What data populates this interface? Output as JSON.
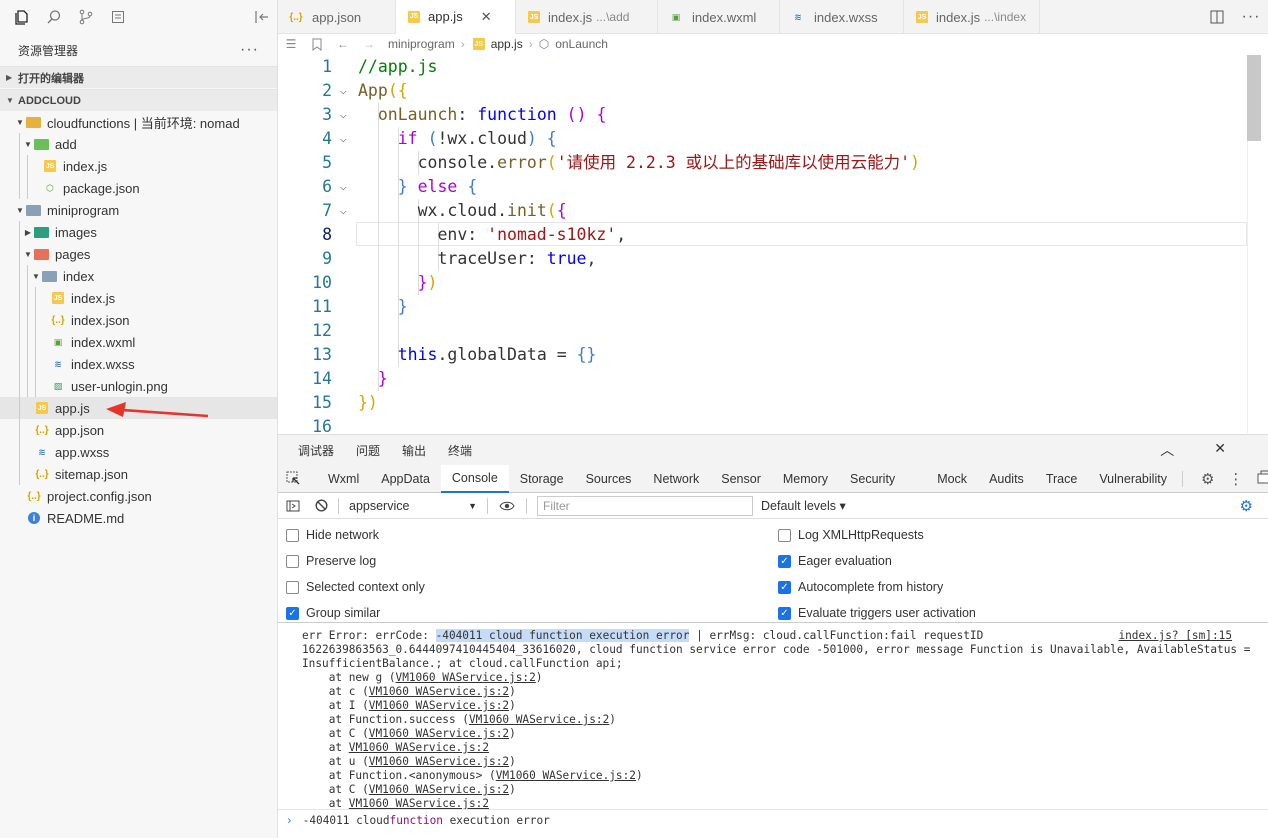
{
  "sidebar": {
    "title": "资源管理器",
    "more": "···",
    "open_editors": "打开的编辑器",
    "project": "ADDCLOUD",
    "tree": [
      {
        "label": "cloudfunctions | 当前环境: nomad",
        "type": "folder",
        "color": "#e8b23a",
        "depth": 0,
        "twisty": "open"
      },
      {
        "label": "add",
        "type": "folder",
        "color": "#6bbf5a",
        "depth": 1,
        "twisty": "open"
      },
      {
        "label": "index.js",
        "type": "js",
        "depth": 2
      },
      {
        "label": "package.json",
        "type": "pkg",
        "depth": 2
      },
      {
        "label": "miniprogram",
        "type": "folder",
        "color": "#8aa0b6",
        "depth": 0,
        "twisty": "open"
      },
      {
        "label": "images",
        "type": "folder",
        "color": "#2a9e7e",
        "depth": 1,
        "twisty": "closed"
      },
      {
        "label": "pages",
        "type": "folder",
        "color": "#e8705a",
        "depth": 1,
        "twisty": "open"
      },
      {
        "label": "index",
        "type": "folder",
        "color": "#8aa0b6",
        "depth": 2,
        "twisty": "open"
      },
      {
        "label": "index.js",
        "type": "js",
        "depth": 3
      },
      {
        "label": "index.json",
        "type": "json",
        "depth": 3
      },
      {
        "label": "index.wxml",
        "type": "wxml",
        "depth": 3
      },
      {
        "label": "index.wxss",
        "type": "wxss",
        "depth": 3
      },
      {
        "label": "user-unlogin.png",
        "type": "img",
        "depth": 3
      },
      {
        "label": "app.js",
        "type": "js",
        "depth": 1,
        "selected": true
      },
      {
        "label": "app.json",
        "type": "json",
        "depth": 1
      },
      {
        "label": "app.wxss",
        "type": "wxss",
        "depth": 1
      },
      {
        "label": "sitemap.json",
        "type": "json",
        "depth": 1
      },
      {
        "label": "project.config.json",
        "type": "json",
        "depth": 0
      },
      {
        "label": "README.md",
        "type": "info",
        "depth": 0
      }
    ]
  },
  "tabs": [
    {
      "label": "app.json",
      "type": "json",
      "sub": ""
    },
    {
      "label": "app.js",
      "type": "js",
      "sub": "",
      "active": true,
      "close": "✕"
    },
    {
      "label": "index.js",
      "type": "js",
      "sub": "...\\add"
    },
    {
      "label": "index.wxml",
      "type": "wxml",
      "sub": ""
    },
    {
      "label": "index.wxss",
      "type": "wxss",
      "sub": ""
    },
    {
      "label": "index.js",
      "type": "js",
      "sub": "...\\index"
    }
  ],
  "breadcrumb": {
    "folder": "miniprogram",
    "file": "app.js",
    "symbol": "onLaunch"
  },
  "editor": {
    "lines": [
      {
        "n": "1",
        "tokens": [
          [
            "c-cm",
            "//app.js"
          ]
        ]
      },
      {
        "n": "2",
        "fold": true,
        "tokens": [
          [
            "c-fn",
            "App"
          ],
          [
            "c-b1",
            "({"
          ]
        ]
      },
      {
        "n": "3",
        "fold": true,
        "tokens": [
          [
            "",
            "  "
          ],
          [
            "c-fn",
            "onLaunch"
          ],
          [
            "",
            ": "
          ],
          [
            "c-kw",
            "function"
          ],
          [
            "",
            " "
          ],
          [
            "c-b2",
            "()"
          ],
          [
            "",
            " "
          ],
          [
            "c-b2",
            "{"
          ]
        ]
      },
      {
        "n": "4",
        "fold": true,
        "tokens": [
          [
            "",
            "    "
          ],
          [
            "c-ctl",
            "if"
          ],
          [
            "",
            " "
          ],
          [
            "c-b3",
            "("
          ],
          [
            "",
            "!wx.cloud"
          ],
          [
            "c-b3",
            ")"
          ],
          [
            "",
            " "
          ],
          [
            "c-b3",
            "{"
          ]
        ]
      },
      {
        "n": "5",
        "tokens": [
          [
            "",
            "      console."
          ],
          [
            "c-fn",
            "error"
          ],
          [
            "c-b1",
            "("
          ],
          [
            "c-str",
            "'请使用 2.2.3 或以上的基础库以使用云能力'"
          ],
          [
            "c-b1",
            ")"
          ]
        ]
      },
      {
        "n": "6",
        "fold": true,
        "tokens": [
          [
            "",
            "    "
          ],
          [
            "c-b3",
            "}"
          ],
          [
            "",
            " "
          ],
          [
            "c-ctl",
            "else"
          ],
          [
            "",
            " "
          ],
          [
            "c-b3",
            "{"
          ]
        ]
      },
      {
        "n": "7",
        "fold": true,
        "tokens": [
          [
            "",
            "      wx.cloud."
          ],
          [
            "c-fn",
            "init"
          ],
          [
            "c-b1",
            "("
          ],
          [
            "c-b2",
            "{"
          ]
        ]
      },
      {
        "n": "8",
        "tokens": [
          [
            "",
            "        env: "
          ],
          [
            "c-str",
            "'nomad-s10kz'"
          ],
          [
            "",
            ","
          ]
        ]
      },
      {
        "n": "9",
        "tokens": [
          [
            "",
            "        traceUser: "
          ],
          [
            "c-kw",
            "true"
          ],
          [
            "",
            ","
          ]
        ]
      },
      {
        "n": "10",
        "tokens": [
          [
            "",
            "      "
          ],
          [
            "c-b2",
            "}"
          ],
          [
            "c-b1",
            ")"
          ]
        ]
      },
      {
        "n": "11",
        "tokens": [
          [
            "",
            "    "
          ],
          [
            "c-b3",
            "}"
          ]
        ]
      },
      {
        "n": "12",
        "tokens": []
      },
      {
        "n": "13",
        "tokens": [
          [
            "",
            "    "
          ],
          [
            "c-kw",
            "this"
          ],
          [
            "",
            ".globalData = "
          ],
          [
            "c-b3",
            "{}"
          ]
        ]
      },
      {
        "n": "14",
        "tokens": [
          [
            "",
            "  "
          ],
          [
            "c-b2",
            "}"
          ]
        ]
      },
      {
        "n": "15",
        "tokens": [
          [
            "c-b1",
            "})"
          ]
        ]
      },
      {
        "n": "16",
        "tokens": []
      }
    ]
  },
  "devtools": {
    "panels": [
      "调试器",
      "问题",
      "输出",
      "终端"
    ],
    "tabs": [
      "Wxml",
      "AppData",
      "Console",
      "Storage",
      "Sources",
      "Network",
      "Sensor",
      "Memory",
      "Security",
      "Mock",
      "Audits",
      "Trace",
      "Vulnerability"
    ],
    "active_tab": "Console",
    "context": "appservice",
    "filter_placeholder": "Filter",
    "levels": "Default levels ▾",
    "options_left": [
      {
        "label": "Hide network",
        "checked": false
      },
      {
        "label": "Preserve log",
        "checked": false
      },
      {
        "label": "Selected context only",
        "checked": false
      },
      {
        "label": "Group similar",
        "checked": true
      }
    ],
    "options_right": [
      {
        "label": "Log XMLHttpRequests",
        "checked": false
      },
      {
        "label": "Eager evaluation",
        "checked": true
      },
      {
        "label": "Autocomplete from history",
        "checked": true
      },
      {
        "label": "Evaluate triggers user activation",
        "checked": true
      }
    ],
    "console": {
      "source": "index.js? [sm]:15",
      "err_prefix": "err Error: errCode: ",
      "err_highlight": "-404011 cloud function execution error",
      "err_suffix": " | errMsg: cloud.callFunction:fail requestID",
      "line2": "1622639863563_0.6444097410445404_33616020, cloud function service error code -501000, error message Function is Unavailable, AvailableStatus =",
      "line3": "InsufficientBalance.; at cloud.callFunction api;",
      "stack": [
        {
          "pre": "    at new g (",
          "link": "VM1060 WAService.js:2",
          "post": ")"
        },
        {
          "pre": "    at c (",
          "link": "VM1060 WAService.js:2",
          "post": ")"
        },
        {
          "pre": "    at I (",
          "link": "VM1060 WAService.js:2",
          "post": ")"
        },
        {
          "pre": "    at Function.success (",
          "link": "VM1060 WAService.js:2",
          "post": ")"
        },
        {
          "pre": "    at C (",
          "link": "VM1060 WAService.js:2",
          "post": ")"
        },
        {
          "pre": "    at ",
          "link": "VM1060 WAService.js:2",
          "post": ""
        },
        {
          "pre": "    at u (",
          "link": "VM1060 WAService.js:2",
          "post": ")"
        },
        {
          "pre": "    at Function.<anonymous> (",
          "link": "VM1060 WAService.js:2",
          "post": ")"
        },
        {
          "pre": "    at C (",
          "link": "VM1060 WAService.js:2",
          "post": ")"
        },
        {
          "pre": "    at ",
          "link": "VM1060 WAService.js:2",
          "post": ""
        }
      ],
      "prompt": {
        "a": "-404011 cloud ",
        "kw1": "function",
        "b": " execution error"
      }
    }
  }
}
